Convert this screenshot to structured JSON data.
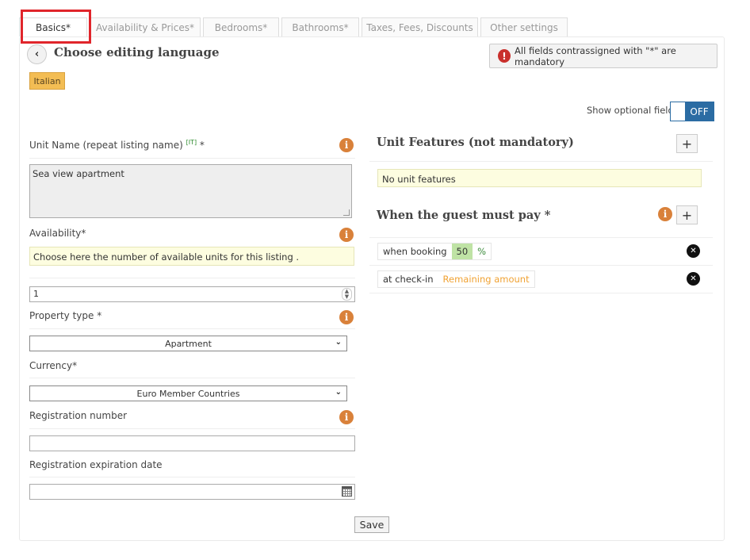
{
  "tabs": [
    {
      "label": "Basics*"
    },
    {
      "label": "Availability & Prices*"
    },
    {
      "label": "Bedrooms*"
    },
    {
      "label": "Bathrooms*"
    },
    {
      "label": "Taxes, Fees, Discounts"
    },
    {
      "label": "Other settings"
    }
  ],
  "header": {
    "title": "Choose editing language",
    "mandatory_note": "All fields contrassigned with \"*\" are mandatory",
    "language": "Italian"
  },
  "optional": {
    "label": "Show optional fields",
    "state": "OFF"
  },
  "fields": {
    "unit_name": {
      "label": "Unit Name (repeat listing name)",
      "lang_tag": "[IT]",
      "required": " *",
      "value": "Sea view apartment"
    },
    "availability": {
      "label": "Availability*",
      "hint": "Choose here the number of available units for this listing .",
      "value": "1"
    },
    "property_type": {
      "label": "Property type *",
      "value": "Apartment"
    },
    "currency": {
      "label": "Currency*",
      "value": "Euro Member Countries"
    },
    "registration_number": {
      "label": "Registration number",
      "value": ""
    },
    "registration_expiration": {
      "label": "Registration expiration date",
      "value": ""
    }
  },
  "unit_features": {
    "title": "Unit Features (not mandatory)",
    "empty": "No unit features"
  },
  "payment": {
    "title": "When the guest must pay *",
    "rows": [
      {
        "label": "when booking",
        "value": "50",
        "unit": "%"
      },
      {
        "label": "at check-in",
        "value": "Remaining amount"
      }
    ]
  },
  "save_label": "Save",
  "icons": {
    "back": "‹",
    "info": "i",
    "exclamation": "!",
    "plus": "+",
    "remove": "✕",
    "chevron": "⌄"
  },
  "colors": {
    "accent": "#2b6ca3",
    "info": "#d9813a",
    "danger": "#c9302c",
    "highlight": "#e0252b",
    "badge": "#f3bd54"
  }
}
